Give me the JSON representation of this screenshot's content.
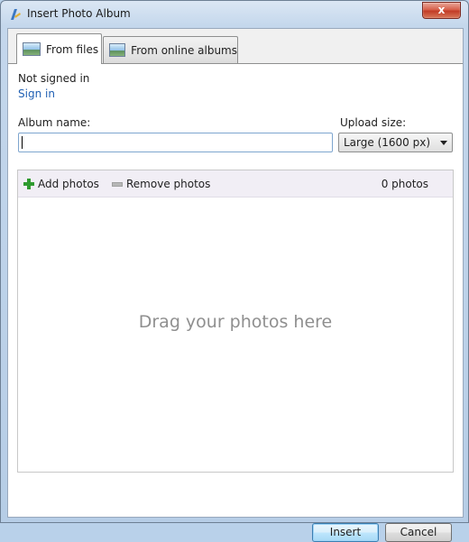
{
  "window": {
    "title": "Insert Photo Album",
    "close_glyph": "x"
  },
  "tabs": [
    {
      "label": "From files",
      "icon": "photo-icon",
      "selected": true
    },
    {
      "label": "From online albums",
      "icon": "photo-icon",
      "selected": false
    }
  ],
  "account": {
    "status": "Not signed in",
    "sign_in_link": "Sign in"
  },
  "album": {
    "label": "Album name:",
    "value": ""
  },
  "upload": {
    "label": "Upload size:",
    "selected": "Large (1600 px)"
  },
  "photos": {
    "add_label": "Add photos",
    "remove_label": "Remove photos",
    "count_text": "0 photos",
    "drop_hint": "Drag your photos here"
  },
  "buttons": {
    "insert": "Insert",
    "cancel": "Cancel"
  },
  "colors": {
    "link": "#1f5fb3",
    "add_icon": "#2f9a2f",
    "toolbar_bg": "#f1eef5",
    "close_button": "#c23c26"
  }
}
